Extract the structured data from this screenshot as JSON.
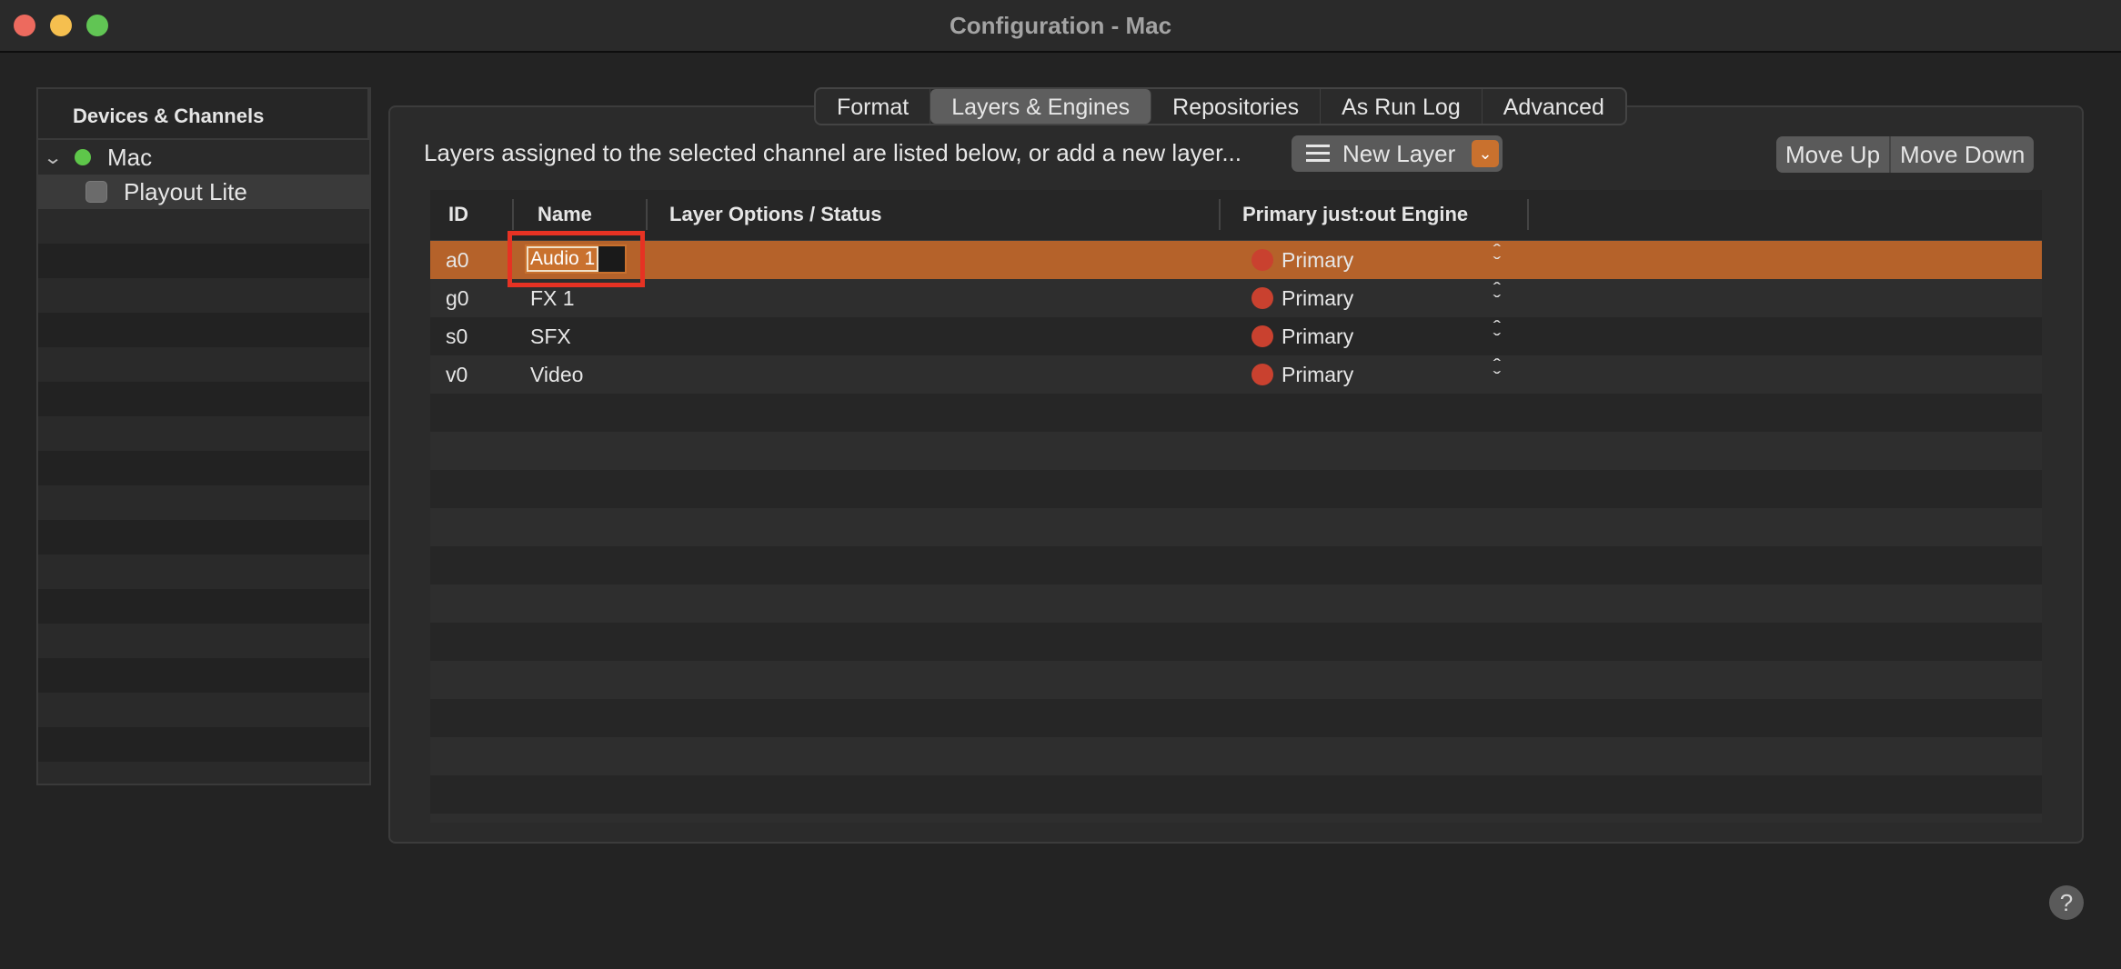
{
  "window": {
    "title": "Configuration - Mac"
  },
  "sidebar": {
    "header": "Devices & Channels",
    "device": {
      "label": "Mac",
      "status_color": "#5ec64a"
    },
    "channel": {
      "label": "Playout Lite"
    }
  },
  "tabs": [
    {
      "label": "Format",
      "active": false
    },
    {
      "label": "Layers & Engines",
      "active": true
    },
    {
      "label": "Repositories",
      "active": false
    },
    {
      "label": "As Run Log",
      "active": false
    },
    {
      "label": "Advanced",
      "active": false
    }
  ],
  "toolbar": {
    "intro_text": "Layers assigned to the selected channel are listed below, or add a new layer...",
    "new_layer_label": "New Layer",
    "move_up_label": "Move Up",
    "move_down_label": "Move Down"
  },
  "table": {
    "columns": [
      "ID",
      "Name",
      "Layer Options / Status",
      "Primary just:out Engine"
    ],
    "rows": [
      {
        "id": "a0",
        "name": "Audio 1",
        "engine": "Primary",
        "selected": true
      },
      {
        "id": "g0",
        "name": "FX 1",
        "engine": "Primary",
        "selected": false
      },
      {
        "id": "s0",
        "name": "SFX",
        "engine": "Primary",
        "selected": false
      },
      {
        "id": "v0",
        "name": "Video",
        "engine": "Primary",
        "selected": false
      }
    ]
  },
  "colors": {
    "accent": "#c9712e",
    "selection": "#b5622a",
    "engine_status": "#c9412f",
    "highlight": "#e63223"
  },
  "help": {
    "label": "?"
  }
}
